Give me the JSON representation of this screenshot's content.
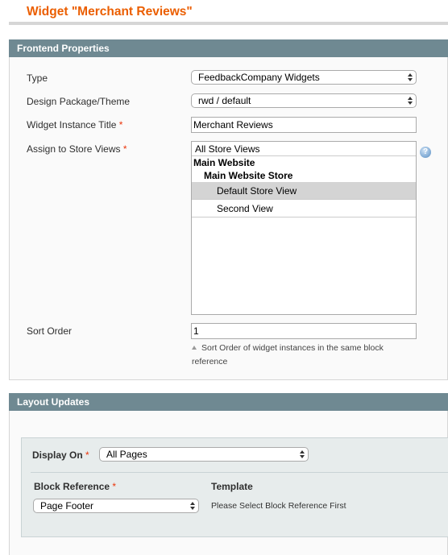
{
  "page": {
    "title": "Widget \"Merchant Reviews\""
  },
  "frontend": {
    "heading": "Frontend Properties",
    "type": {
      "label": "Type",
      "value": "FeedbackCompany Widgets"
    },
    "theme": {
      "label": "Design Package/Theme",
      "value": "rwd / default"
    },
    "instance_title": {
      "label": "Widget Instance Title",
      "required": "*",
      "value": "Merchant Reviews"
    },
    "store_views": {
      "label": "Assign to Store Views",
      "required": "*",
      "options": {
        "all": "All Store Views",
        "website": "Main Website",
        "store": "Main Website Store",
        "view1": "Default Store View",
        "view2": "Second View"
      },
      "selected": "Default Store View",
      "help_icon": "?"
    },
    "sort_order": {
      "label": "Sort Order",
      "value": "1",
      "note": "Sort Order of widget instances in the same block reference"
    }
  },
  "layout": {
    "heading": "Layout Updates",
    "display_on": {
      "label": "Display On",
      "required": "*",
      "value": "All Pages"
    },
    "block_reference": {
      "label": "Block Reference",
      "required": "*",
      "value": "Page Footer"
    },
    "template": {
      "label": "Template",
      "value": "Please Select Block Reference First"
    }
  }
}
